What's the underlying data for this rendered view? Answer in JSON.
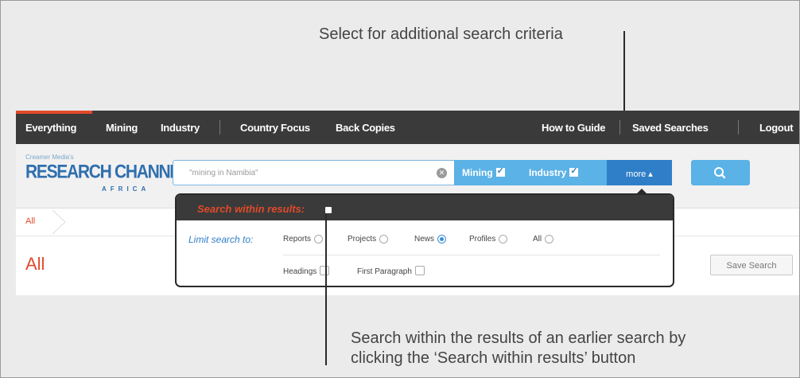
{
  "annotations": {
    "top": "Select for additional search criteria",
    "bottom_line1": "Search within the results of an earlier search by",
    "bottom_line2": "clicking the ‘Search within results’ button"
  },
  "nav": {
    "left": [
      "Everything",
      "Mining",
      "Industry",
      "Country Focus",
      "Back Copies"
    ],
    "right": [
      "How to Guide",
      "Saved Searches",
      "Logout"
    ],
    "active": "Everything"
  },
  "logo": {
    "publisher": "Creamer Media's",
    "name": "RESEARCH CHANNEL",
    "region": "AFRICA"
  },
  "search": {
    "query": "\"mining in Namibia\"",
    "filters": [
      {
        "label": "Mining",
        "checked": true
      },
      {
        "label": "Industry",
        "checked": true
      }
    ],
    "more_label": "more ▴",
    "search_icon": "search-icon"
  },
  "breadcrumb": [
    "All"
  ],
  "page": {
    "title": "All",
    "save_search_label": "Save Search"
  },
  "dropdown": {
    "search_within_label": "Search within results:",
    "search_within_checked": false,
    "limit_label": "Limit search to:",
    "type_options": [
      {
        "label": "Reports",
        "selected": false
      },
      {
        "label": "Projects",
        "selected": false
      },
      {
        "label": "News",
        "selected": true
      },
      {
        "label": "Profiles",
        "selected": false
      },
      {
        "label": "All",
        "selected": false
      }
    ],
    "field_options": [
      {
        "label": "Headings",
        "checked": false
      },
      {
        "label": "First Paragraph",
        "checked": false
      }
    ]
  },
  "colors": {
    "accent": "#e14a2a",
    "brand_blue": "#2f6fae",
    "button_blue": "#5ab2e6",
    "nav_bg": "#3a3a3a"
  }
}
